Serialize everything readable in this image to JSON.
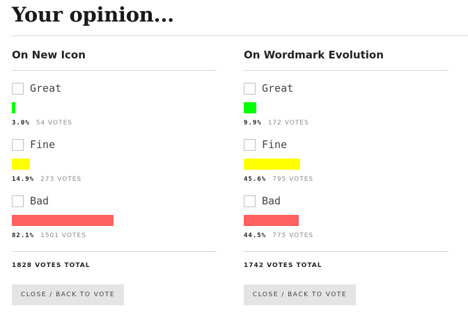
{
  "page": {
    "title": "Your opinion..."
  },
  "polls": [
    {
      "heading": "On New Icon",
      "options": [
        {
          "label": "Great",
          "percent_label": "3.0%",
          "percent": 3.0,
          "votes_label": "54 VOTES",
          "color": "#00ff00"
        },
        {
          "label": "Fine",
          "percent_label": "14.9%",
          "percent": 14.9,
          "votes_label": "273 VOTES",
          "color": "#ffff00"
        },
        {
          "label": "Bad",
          "percent_label": "82.1%",
          "percent": 82.1,
          "votes_label": "1501 VOTES",
          "color": "#ff6060"
        }
      ],
      "total_label": "1828 VOTES TOTAL",
      "close_button": "CLOSE / BACK TO VOTE"
    },
    {
      "heading": "On Wordmark Evolution",
      "options": [
        {
          "label": "Great",
          "percent_label": "9.9%",
          "percent": 9.9,
          "votes_label": "172 VOTES",
          "color": "#00ff00"
        },
        {
          "label": "Fine",
          "percent_label": "45.6%",
          "percent": 45.6,
          "votes_label": "795 VOTES",
          "color": "#ffff00"
        },
        {
          "label": "Bad",
          "percent_label": "44.5%",
          "percent": 44.5,
          "votes_label": "775 VOTES",
          "color": "#ff6060"
        }
      ],
      "total_label": "1742 VOTES TOTAL",
      "close_button": "CLOSE / BACK TO VOTE"
    }
  ]
}
